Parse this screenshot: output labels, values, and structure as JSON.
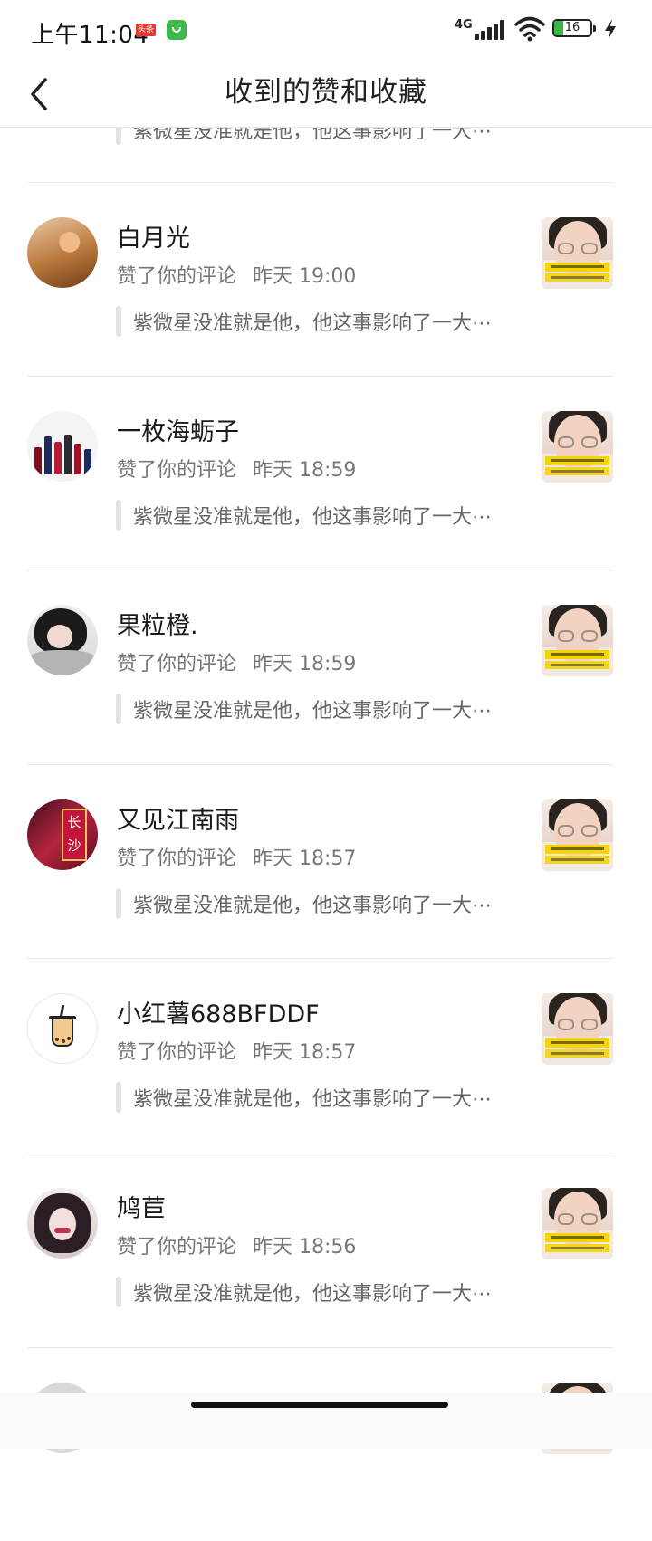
{
  "status_bar": {
    "time": "上午11:04",
    "badge_toutiao": "头条",
    "network": "4G",
    "battery": "16"
  },
  "header": {
    "title": "收到的赞和收藏"
  },
  "partial_top_quote": "紫微星没准就是他，他这事影响了一大⋯",
  "items": [
    {
      "name": "白月光",
      "action": "赞了你的评论",
      "time": "昨天 19:00",
      "quote": "紫微星没准就是他，他这事影响了一大⋯"
    },
    {
      "name": "一枚海蛎子",
      "action": "赞了你的评论",
      "time": "昨天 18:59",
      "quote": "紫微星没准就是他，他这事影响了一大⋯"
    },
    {
      "name": "果粒橙.",
      "action": "赞了你的评论",
      "time": "昨天 18:59",
      "quote": "紫微星没准就是他，他这事影响了一大⋯"
    },
    {
      "name": "又见江南雨",
      "action": "赞了你的评论",
      "time": "昨天 18:57",
      "quote": "紫微星没准就是他，他这事影响了一大⋯"
    },
    {
      "name": "小红薯688BFDDF",
      "action": "赞了你的评论",
      "time": "昨天 18:57",
      "quote": "紫微星没准就是他，他这事影响了一大⋯"
    },
    {
      "name": "鸠苣",
      "action": "赞了你的评论",
      "time": "昨天 18:56",
      "quote": "紫微星没准就是他，他这事影响了一大⋯"
    }
  ],
  "avatar4_sign": "长沙",
  "colors": {
    "accent_battery": "#39b54a",
    "divider": "#e8e8e8",
    "meta_text": "#777777"
  }
}
